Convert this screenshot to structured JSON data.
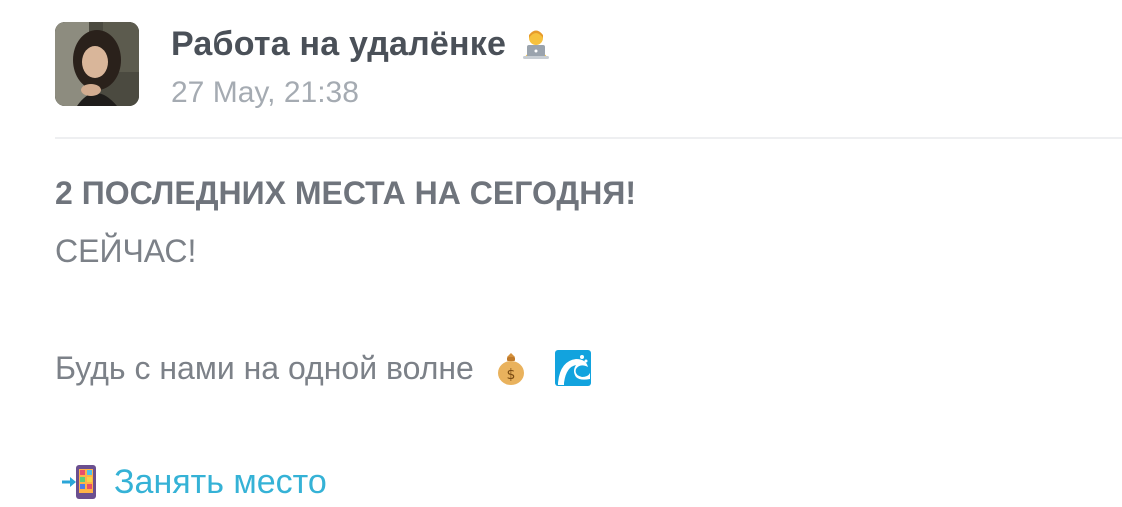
{
  "post": {
    "channel_name": "Работа на удалёнке",
    "channel_emoji": "person-with-laptop-icon",
    "date": "27 May, 21:38",
    "headline": "2 ПОСЛЕДНИХ МЕСТА НА СЕГОДНЯ!",
    "subline": "СЕЙЧАС!",
    "body_text": "Будь с нами на одной волне",
    "body_emojis": [
      "money-bag-icon",
      "water-wave-icon"
    ],
    "cta": {
      "icon": "mobile-phone-arrow-icon",
      "label": "Занять место"
    }
  },
  "colors": {
    "title": "#4a5058",
    "date": "#a5abb2",
    "text": "#7c8188",
    "link": "#35b2d6",
    "divider": "#eeeff1"
  }
}
